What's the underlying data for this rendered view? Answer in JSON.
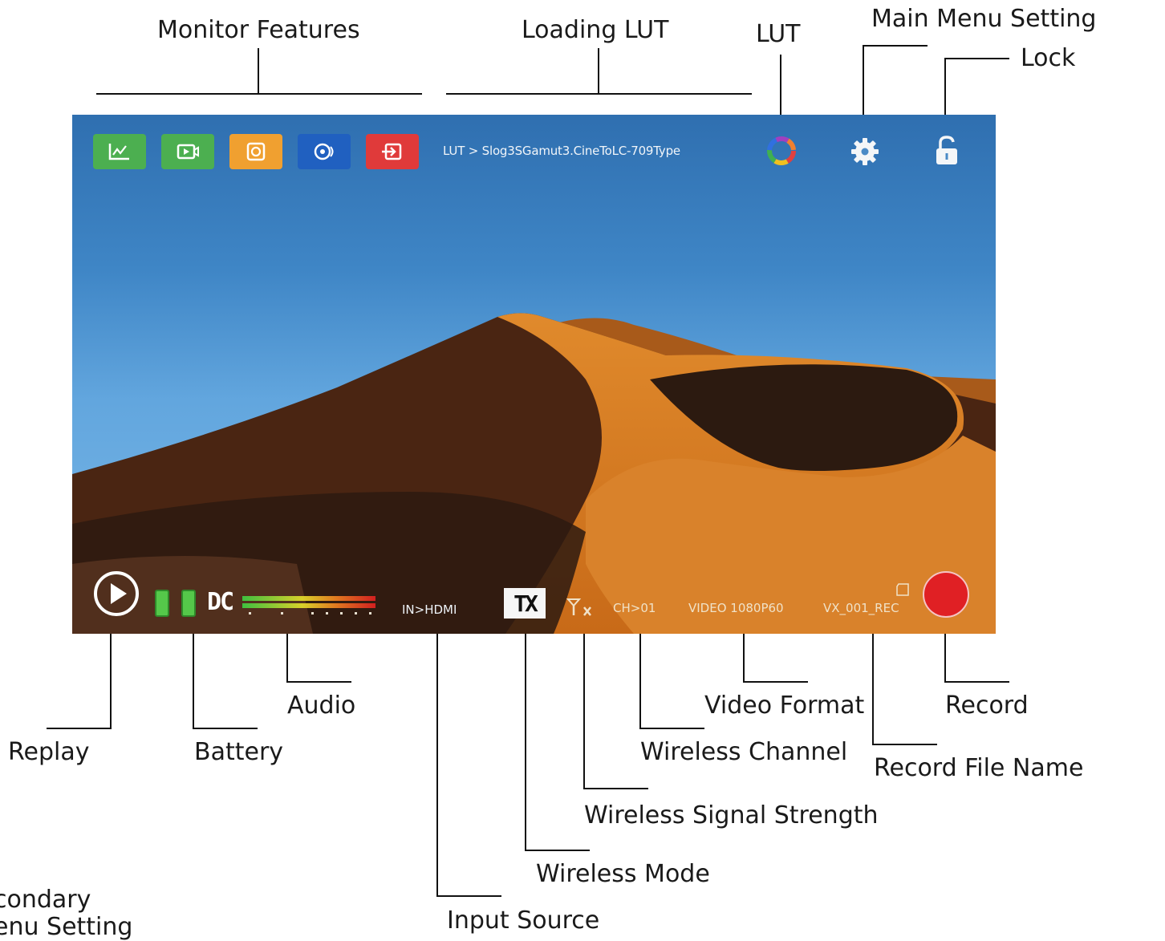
{
  "callouts": {
    "monitor_features": "Monitor Features",
    "loading_lut": "Loading LUT",
    "lut": "LUT",
    "main_menu_setting": "Main Menu Setting",
    "lock": "Lock",
    "replay": "Replay",
    "battery": "Battery",
    "audio": "Audio",
    "input_source": "Input Source",
    "wireless_mode": "Wireless Mode",
    "wireless_signal_strength": "Wireless Signal Strength",
    "wireless_channel": "Wireless Channel",
    "video_format": "Video Format",
    "record_file_name": "Record File Name",
    "record": "Record",
    "secondary_menu_setting": "condary\nenu Setting"
  },
  "screen": {
    "lut_path": "LUT > Slog3SGamut3.CineToLC-709Type",
    "dc_label": "DC",
    "input_source": "IN>HDMI",
    "wireless_mode": "TX",
    "wireless_channel": "CH>01",
    "video_format": "VIDEO 1080P60",
    "record_file_name": "VX_001_REC",
    "feature_buttons": [
      {
        "name": "waveform",
        "color": "#4caf50"
      },
      {
        "name": "video",
        "color": "#4caf50"
      },
      {
        "name": "focus",
        "color": "#f0a030"
      },
      {
        "name": "audio-sync",
        "color": "#2060c0"
      },
      {
        "name": "input-switch",
        "color": "#e03a3a"
      }
    ]
  },
  "icons": [
    "waveform-icon",
    "video-icon",
    "focus-icon",
    "audio-sync-icon",
    "input-switch-icon",
    "lut-icon",
    "gear-icon",
    "lock-icon",
    "replay-icon",
    "signal-icon",
    "card-icon",
    "record-icon"
  ],
  "colors": {
    "record": "#e02024",
    "sky": "#3f86c6",
    "sand": "#d9822b"
  }
}
